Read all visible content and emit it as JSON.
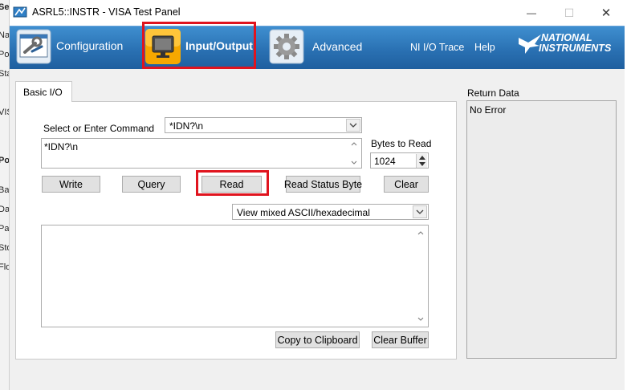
{
  "window": {
    "title": "ASRL5::INSTR - VISA Test Panel",
    "minimize_glyph": "—",
    "maximize_glyph": "☐",
    "close_glyph": "✕"
  },
  "background_window": {
    "fragments": [
      "Se",
      "Na",
      "Po",
      "Sta",
      "VIS",
      "Po",
      "Ba",
      "Da",
      "Pa",
      "Sto",
      "Flo"
    ]
  },
  "ribbon": {
    "tabs": [
      {
        "label": "Configuration",
        "icon": "config-icon"
      },
      {
        "label": "Input/Output",
        "icon": "input-output-icon",
        "selected": true
      },
      {
        "label": "Advanced",
        "icon": "gear-icon"
      }
    ],
    "links": {
      "trace": "NI I/O Trace",
      "help": "Help"
    },
    "logo": {
      "line1": "NATIONAL",
      "line2": "INSTRUMENTS"
    }
  },
  "basic_io": {
    "tab_label": "Basic I/O",
    "command_label": "Select or Enter Command",
    "command_combo_value": "*IDN?\\n",
    "command_text": "*IDN?\\n",
    "bytes_label": "Bytes to Read",
    "bytes_value": "1024",
    "buttons": {
      "write": "Write",
      "query": "Query",
      "read": "Read",
      "read_status": "Read Status Byte",
      "clear": "Clear",
      "copy": "Copy to Clipboard",
      "clear_buffer": "Clear Buffer"
    },
    "view_mode": "View mixed ASCII/hexadecimal",
    "output_text": ""
  },
  "return_data": {
    "label": "Return Data",
    "value": "No Error"
  },
  "colors": {
    "ribbon": "#2a71b3",
    "highlight": "#e0141e"
  }
}
